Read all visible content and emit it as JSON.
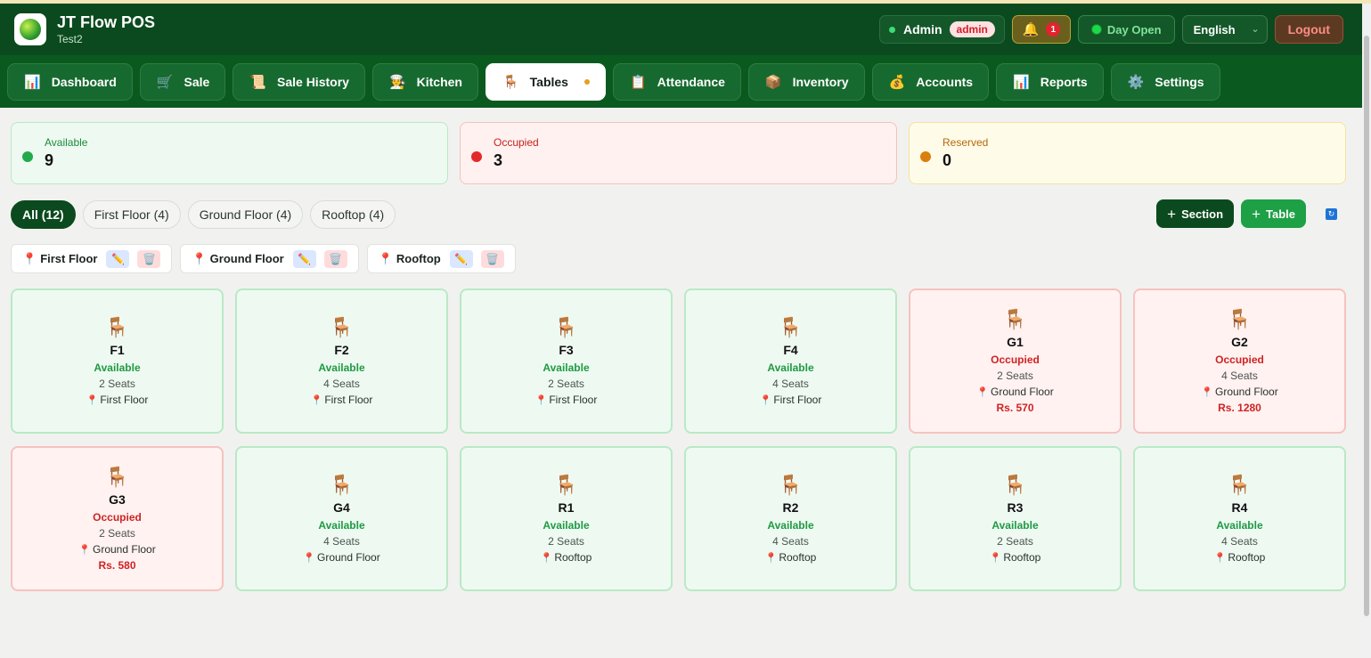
{
  "app": {
    "title": "JT Flow POS",
    "subtitle": "Test2"
  },
  "header": {
    "user_name": "Admin",
    "role": "admin",
    "notification_count": "1",
    "day_status": "Day Open",
    "language": "English",
    "logout_label": "Logout"
  },
  "nav": {
    "items": [
      {
        "label": "Dashboard",
        "icon": "📊"
      },
      {
        "label": "Sale",
        "icon": "🛒"
      },
      {
        "label": "Sale History",
        "icon": "📜"
      },
      {
        "label": "Kitchen",
        "icon": "🧑‍🍳"
      },
      {
        "label": "Tables",
        "icon": "🪑",
        "active": true
      },
      {
        "label": "Attendance",
        "icon": "📋"
      },
      {
        "label": "Inventory",
        "icon": "📦"
      },
      {
        "label": "Accounts",
        "icon": "💰"
      },
      {
        "label": "Reports",
        "icon": "📊"
      },
      {
        "label": "Settings",
        "icon": "⚙️"
      }
    ]
  },
  "stats": {
    "available": {
      "label": "Available",
      "value": "9"
    },
    "occupied": {
      "label": "Occupied",
      "value": "3"
    },
    "reserved": {
      "label": "Reserved",
      "value": "0"
    }
  },
  "filters": {
    "all": "All (12)",
    "first_floor": "First Floor (4)",
    "ground_floor": "Ground Floor (4)",
    "rooftop": "Rooftop (4)"
  },
  "actions": {
    "add_section": "Section",
    "add_table": "Table"
  },
  "sections": [
    "First Floor",
    "Ground Floor",
    "Rooftop"
  ],
  "tables": [
    {
      "name": "F1",
      "status": "Available",
      "seats": "2 Seats",
      "location": "First Floor",
      "amount": ""
    },
    {
      "name": "F2",
      "status": "Available",
      "seats": "4 Seats",
      "location": "First Floor",
      "amount": ""
    },
    {
      "name": "F3",
      "status": "Available",
      "seats": "2 Seats",
      "location": "First Floor",
      "amount": ""
    },
    {
      "name": "F4",
      "status": "Available",
      "seats": "4 Seats",
      "location": "First Floor",
      "amount": ""
    },
    {
      "name": "G1",
      "status": "Occupied",
      "seats": "2 Seats",
      "location": "Ground Floor",
      "amount": "Rs. 570"
    },
    {
      "name": "G2",
      "status": "Occupied",
      "seats": "4 Seats",
      "location": "Ground Floor",
      "amount": "Rs. 1280"
    },
    {
      "name": "G3",
      "status": "Occupied",
      "seats": "2 Seats",
      "location": "Ground Floor",
      "amount": "Rs. 580"
    },
    {
      "name": "G4",
      "status": "Available",
      "seats": "4 Seats",
      "location": "Ground Floor",
      "amount": ""
    },
    {
      "name": "R1",
      "status": "Available",
      "seats": "2 Seats",
      "location": "Rooftop",
      "amount": ""
    },
    {
      "name": "R2",
      "status": "Available",
      "seats": "4 Seats",
      "location": "Rooftop",
      "amount": ""
    },
    {
      "name": "R3",
      "status": "Available",
      "seats": "2 Seats",
      "location": "Rooftop",
      "amount": ""
    },
    {
      "name": "R4",
      "status": "Available",
      "seats": "4 Seats",
      "location": "Rooftop",
      "amount": ""
    }
  ],
  "colors": {
    "brand_dark": "#0b4a1e",
    "available": "#1e9a43",
    "occupied": "#cf2323",
    "reserved": "#db7e0d"
  }
}
